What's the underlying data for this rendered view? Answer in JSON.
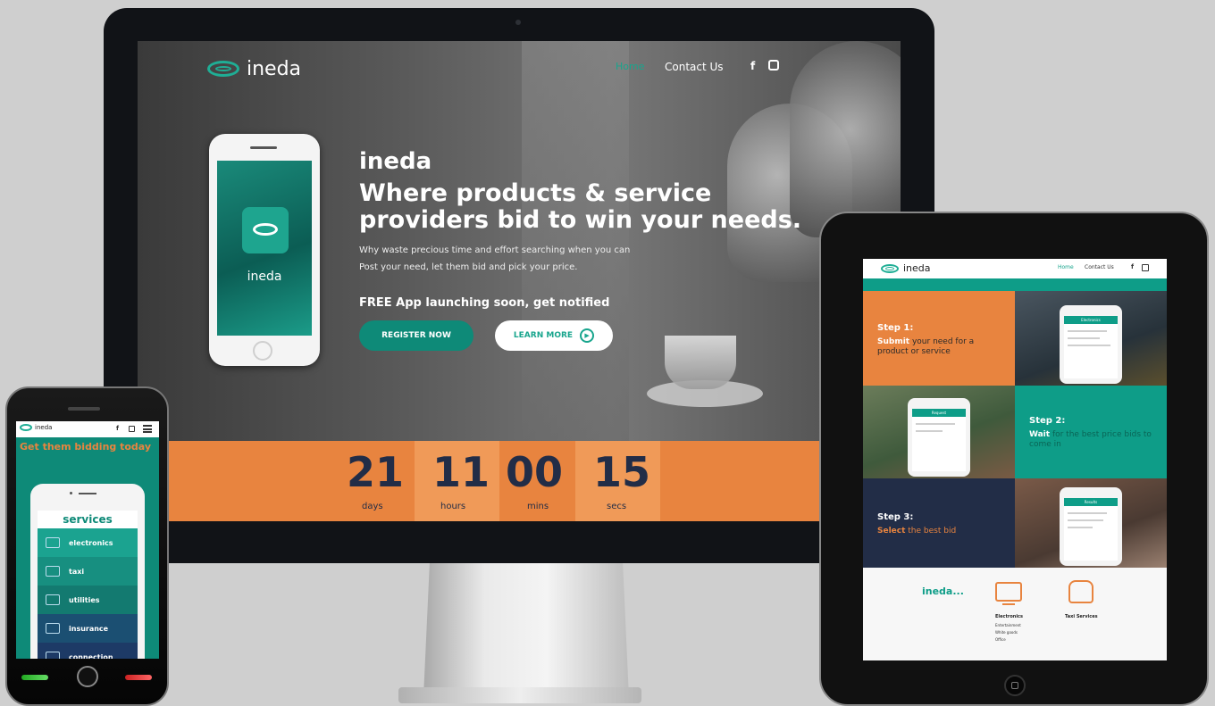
{
  "brand": {
    "logo_text": "ineda",
    "teal": "#18a58d",
    "orange": "#e8843f",
    "navy": "#222d47"
  },
  "desktop": {
    "nav": {
      "home": "Home",
      "contact": "Contact Us",
      "facebook": "f",
      "instagram_icon": "instagram-icon"
    },
    "phone_label": "ineda",
    "hero": {
      "brand": "ineda",
      "headline_1": "Where products & service",
      "headline_2": "providers bid to win your needs.",
      "sub_1": "Why waste precious time and effort searching when you can",
      "sub_2": "Post your need, let them bid and pick your price.",
      "cta_text": "FREE App launching soon, get notified",
      "register_label": "REGISTER NOW",
      "learn_label": "LEARN MORE"
    },
    "countdown": [
      {
        "value": "21",
        "label": "days"
      },
      {
        "value": "11",
        "label": "hours"
      },
      {
        "value": "00",
        "label": "mins"
      },
      {
        "value": "15",
        "label": "secs"
      }
    ]
  },
  "tablet": {
    "nav": {
      "logo": "ineda",
      "home": "Home",
      "contact": "Contact Us",
      "facebook": "f"
    },
    "step1": {
      "title": "Step 1:",
      "action": "Submit",
      "rest": " your need for a product or service"
    },
    "step2": {
      "title": "Step 2:",
      "action": "Wait",
      "rest": " for the best price bids to come in"
    },
    "step3": {
      "title": "Step 3:",
      "action": "Select",
      "rest": " the best bid"
    },
    "mini_screens": [
      "Electronics",
      "Request",
      "Results"
    ],
    "footer": {
      "brand": "ineda...",
      "cat_1": "Electronics",
      "cat_2": "Taxi Services",
      "sub_1": "Entertainment",
      "sub_2": "White goods",
      "sub_3": "Office"
    }
  },
  "phone": {
    "nav": {
      "logo": "ineda",
      "facebook": "f"
    },
    "headline": "Get them bidding today",
    "services_title": "services",
    "services": [
      "electronics",
      "taxi",
      "utilities",
      "insurance",
      "connection"
    ]
  }
}
